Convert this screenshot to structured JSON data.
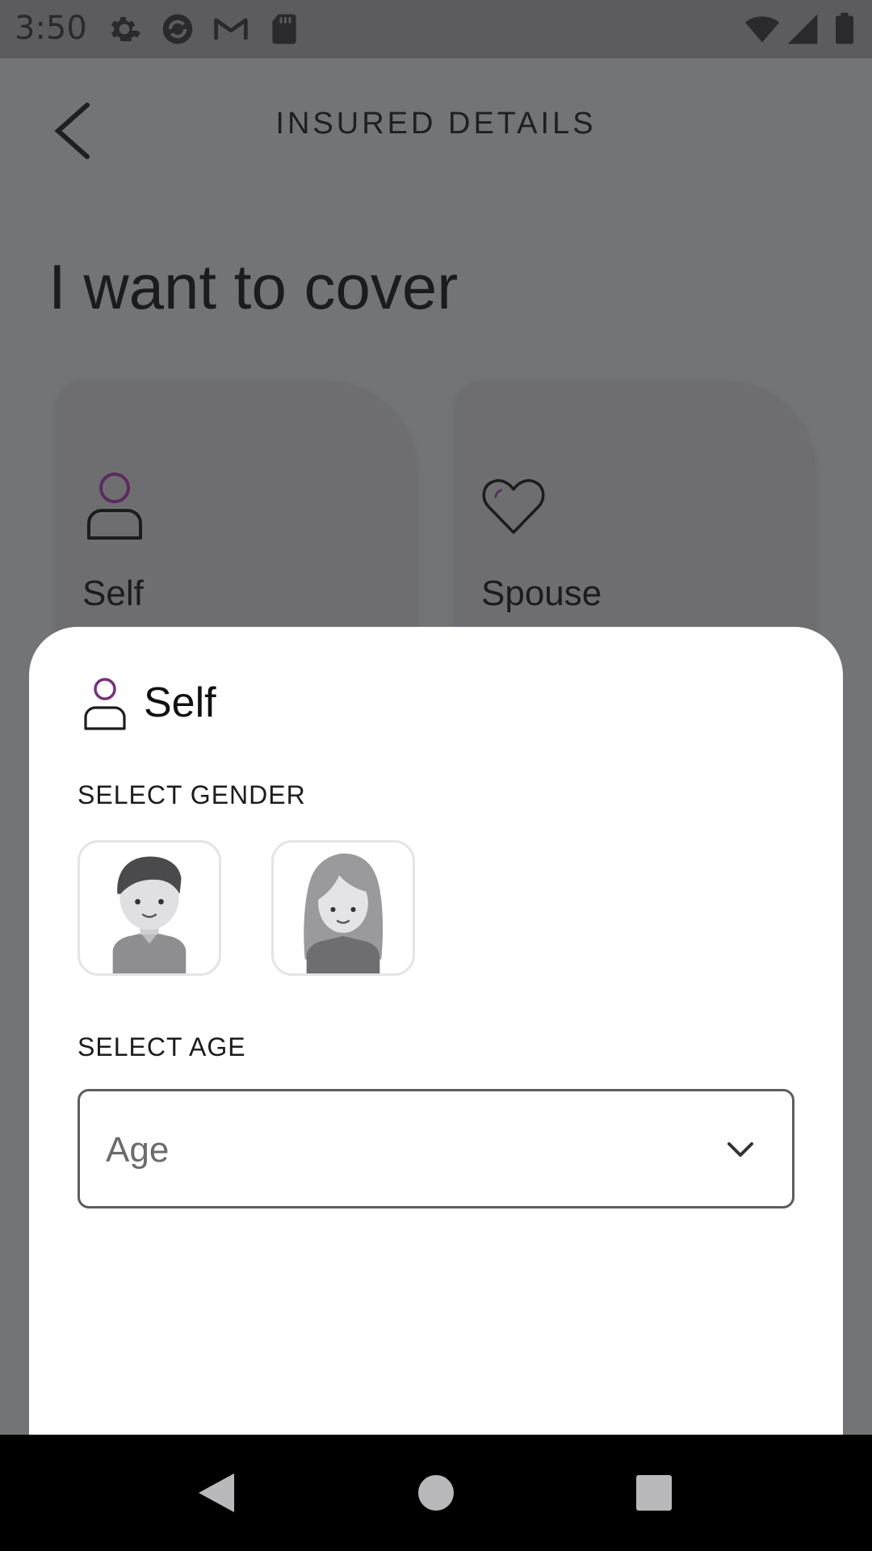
{
  "status_bar": {
    "time": "3:50",
    "left_icons": [
      "gear-icon",
      "sync-icon",
      "gmail-icon",
      "sd-card-icon"
    ],
    "right_icons": [
      "wifi-icon",
      "signal-icon",
      "battery-icon"
    ]
  },
  "app_bar": {
    "title": "INSURED DETAILS",
    "back_icon": "chevron-left-icon"
  },
  "page": {
    "heading": "I want to cover"
  },
  "cards": [
    {
      "label": "Self",
      "icon": "person-icon"
    },
    {
      "label": "Spouse",
      "icon": "heart-icon"
    }
  ],
  "sheet": {
    "title": "Self",
    "icon": "person-icon",
    "gender_label": "SELECT GENDER",
    "gender_options": [
      "male-avatar-icon",
      "female-avatar-icon"
    ],
    "age_label": "SELECT AGE",
    "age_placeholder": "Age"
  },
  "nav_bar": {
    "buttons": [
      "back-triangle-icon",
      "home-circle-icon",
      "recents-square-icon"
    ]
  },
  "colors": {
    "accent": "#7a2d7e",
    "scrim": "#737478",
    "sheet": "#ffffff"
  }
}
